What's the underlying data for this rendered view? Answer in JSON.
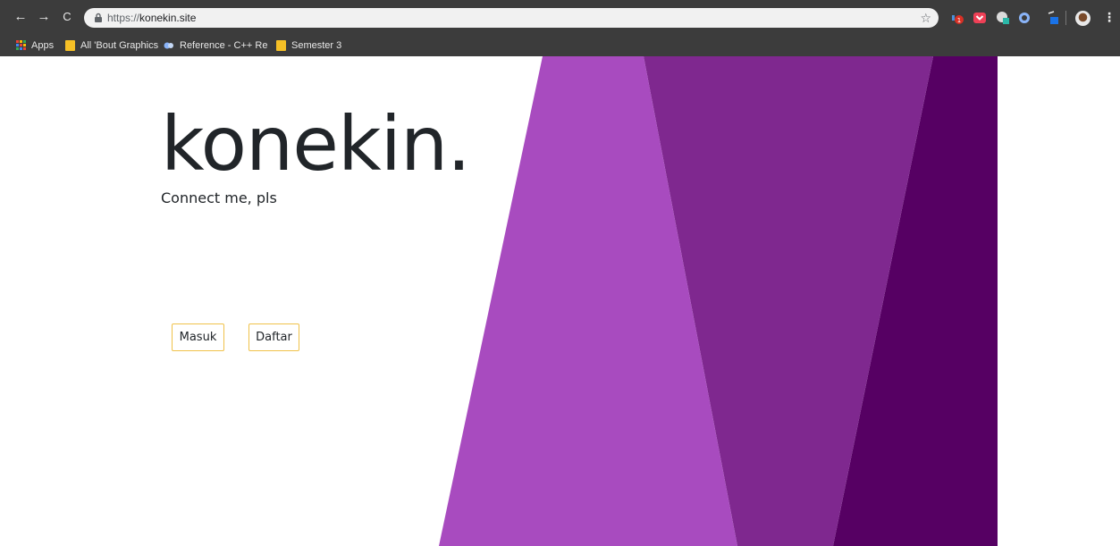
{
  "browser": {
    "nav": {
      "back": "←",
      "forward": "→",
      "reload": "C"
    },
    "url": {
      "protocol": "https://",
      "host": "konekin.site"
    },
    "star": "☆",
    "menu": "⋮",
    "extensions": [
      "extension-icon",
      "pocket-icon",
      "extension-icon",
      "extension-icon",
      "extension-icon",
      "profile-avatar"
    ]
  },
  "bookmarks": [
    {
      "label": "Apps",
      "icon": "apps-grid-icon"
    },
    {
      "label": "All 'Bout Graphics",
      "icon": "folder-icon"
    },
    {
      "label": "Reference - C++ Refe",
      "icon": "site-favicon"
    },
    {
      "label": "Semester 3",
      "icon": "folder-icon"
    }
  ],
  "page": {
    "brand": "konekin.",
    "tagline": "Connect me, pls",
    "buttons": {
      "login": "Masuk",
      "register": "Daftar"
    }
  },
  "colors": {
    "chrome": "#3c3c3c",
    "purple_light": "#a84bbf",
    "purple_mid": "#7f288f",
    "purple_dark": "#560063",
    "button_border": "#f0c24a",
    "text": "#212529"
  }
}
